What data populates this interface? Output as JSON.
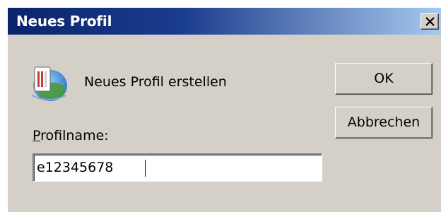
{
  "window": {
    "title": "Neues Profil",
    "close_label": "Close"
  },
  "icon": "profile-mail-icon",
  "heading": "Neues Profil erstellen",
  "profile_name": {
    "label_accel": "P",
    "label_rest": "rofilname:",
    "value": "e12345678"
  },
  "buttons": {
    "ok": "OK",
    "cancel": "Abbrechen"
  },
  "colors": {
    "face": "#d4d0c8",
    "title_start": "#0a246a",
    "title_end": "#a6caf0"
  }
}
